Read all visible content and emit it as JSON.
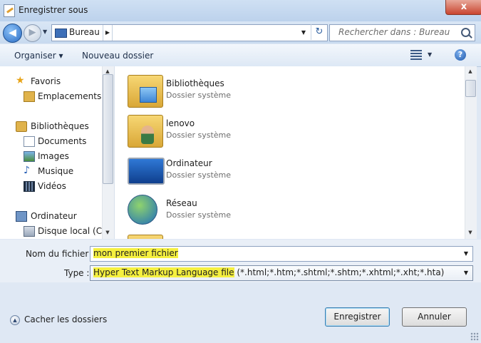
{
  "window": {
    "title": "Enregistrer sous",
    "close_label": "x"
  },
  "navigation": {
    "back_glyph": "◀",
    "forward_glyph": "▶",
    "address": {
      "location": "Bureau",
      "separator": "▶"
    },
    "refresh_glyph": "↻",
    "search_placeholder": "Rechercher dans : Bureau"
  },
  "toolbar": {
    "organize_label": "Organiser ▾",
    "new_folder_label": "Nouveau dossier",
    "views_dropdown": "▼",
    "help_label": "?"
  },
  "sidebar": {
    "favoris": "Favoris",
    "emplacements": "Emplacements ré",
    "bibliotheques": "Bibliothèques",
    "documents": "Documents",
    "images": "Images",
    "musique": "Musique",
    "videos": "Vidéos",
    "ordinateur": "Ordinateur",
    "disque": "Disque local (C:)"
  },
  "files": [
    {
      "name": "Bibliothèques",
      "type": "Dossier système",
      "icon": "library-icon"
    },
    {
      "name": "lenovo",
      "type": "Dossier système",
      "icon": "user-folder-icon"
    },
    {
      "name": "Ordinateur",
      "type": "Dossier système",
      "icon": "computer-icon"
    },
    {
      "name": "Réseau",
      "type": "Dossier système",
      "icon": "network-icon"
    }
  ],
  "form": {
    "filename_label": "Nom du fichier :",
    "filename_value": "mon premier fichier",
    "type_label": "Type :",
    "type_value_highlight": "Hyper Text Markup Language file",
    "type_value_rest": " (*.html;*.htm;*.shtml;*.shtm;*.xhtml;*.xht;*.hta)"
  },
  "footer": {
    "hide_folders_label": "Cacher les dossiers",
    "save_label": "Enregistrer",
    "cancel_label": "Annuler"
  },
  "colors": {
    "highlight": "#f5f03f",
    "chrome": "#dfe8f4",
    "accent": "#2a6cc4"
  }
}
